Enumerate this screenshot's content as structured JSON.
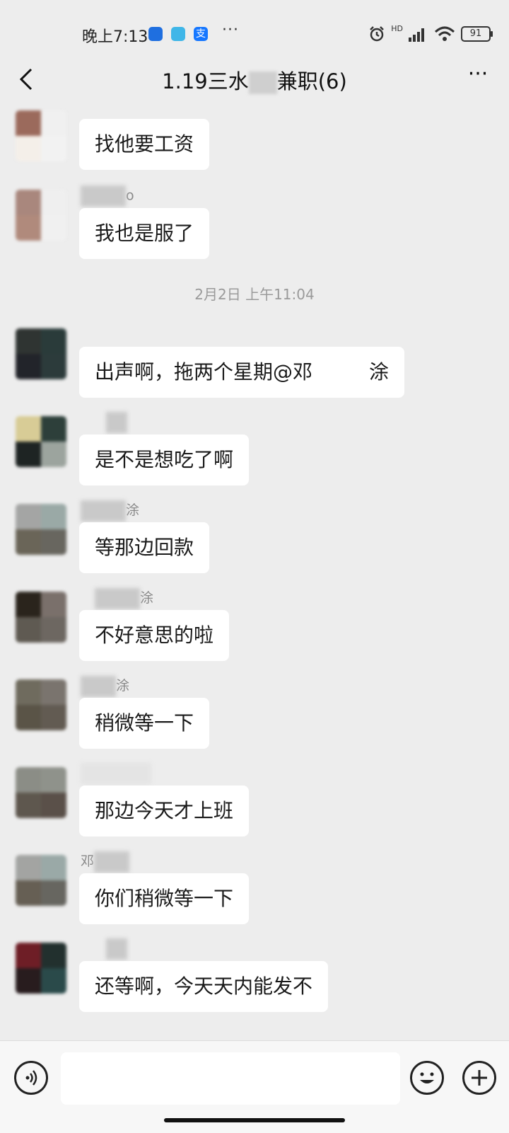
{
  "status_bar": {
    "time": "晚上7:13",
    "apps": [
      "bot-app-icon",
      "game-app-icon",
      "alipay-icon"
    ],
    "more": "···",
    "network": "HD",
    "battery": "91"
  },
  "header": {
    "title": "1.19三水",
    "title_suffix": "兼职(6)",
    "more_label": "···"
  },
  "messages": [
    {
      "sender": "",
      "text": "找他要工资"
    },
    {
      "sender": "o",
      "text": "我也是服了"
    },
    {
      "sender": "",
      "text": "出声啊，拖两个星期@邓",
      "text_suffix": "涂"
    },
    {
      "sender": "",
      "text": "是不是想吃了啊"
    },
    {
      "sender": "涂",
      "text": "等那边回款"
    },
    {
      "sender": "涂",
      "text": "不好意思的啦"
    },
    {
      "sender": "涂",
      "text": "稍微等一下"
    },
    {
      "sender": "",
      "text": "那边今天才上班"
    },
    {
      "sender": "邓",
      "text": "你们稍微等一下"
    },
    {
      "sender": "",
      "text": "还等啊，今天天内能发不"
    }
  ],
  "timestamp": "2月2日 上午11:04",
  "colors": {
    "background": "#ededed",
    "bubble": "#ffffff",
    "input_bar": "#f7f7f7"
  }
}
